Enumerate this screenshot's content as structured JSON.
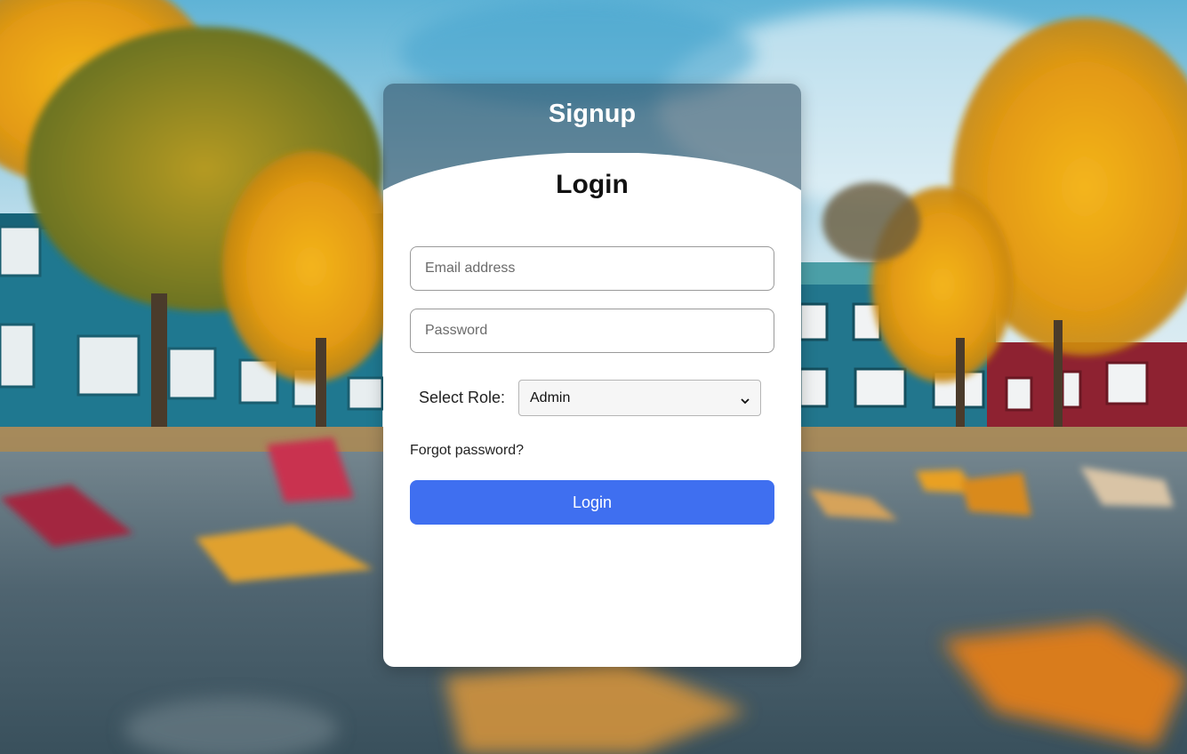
{
  "colors": {
    "accent": "#3f6ff0",
    "card_background": "#ffffff",
    "header_overlay": "#28465a"
  },
  "signup_tab": {
    "label": "Signup"
  },
  "login_form": {
    "title": "Login",
    "email": {
      "placeholder": "Email address",
      "value": ""
    },
    "password": {
      "placeholder": "Password",
      "value": ""
    },
    "role": {
      "label": "Select Role:",
      "selected": "Admin",
      "icon": "chevron-down-icon"
    },
    "forgot_password": "Forgot password?",
    "submit_label": "Login"
  }
}
